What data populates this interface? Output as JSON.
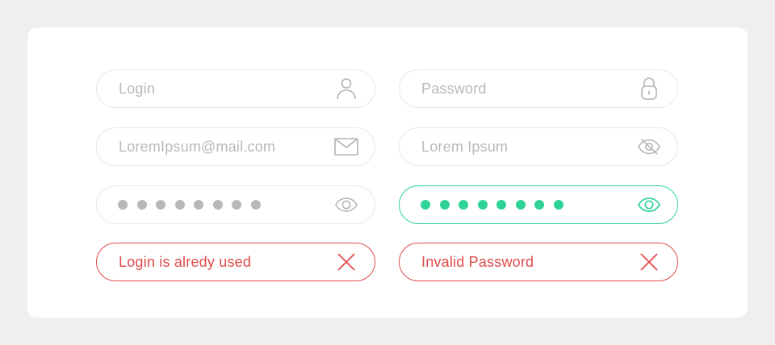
{
  "fields": {
    "login": {
      "placeholder": "Login",
      "icon": "user-icon"
    },
    "password": {
      "placeholder": "Password",
      "icon": "lock-icon"
    },
    "email": {
      "value": "LoremIpsum@mail.com",
      "icon": "mail-icon"
    },
    "name": {
      "value": "Lorem Ipsum",
      "icon": "eye-off-icon"
    },
    "password_hidden": {
      "masked_length": 8,
      "icon": "eye-icon",
      "state": "default"
    },
    "password_visible": {
      "masked_length": 8,
      "icon": "eye-icon",
      "state": "valid"
    },
    "login_error": {
      "message": "Login is alredy used",
      "icon": "close-icon",
      "state": "error"
    },
    "password_error": {
      "message": "Invalid Password",
      "icon": "close-icon",
      "state": "error"
    }
  },
  "colors": {
    "background": "#efefef",
    "card": "#ffffff",
    "border": "#e7e7e7",
    "placeholder": "#b9b9b9",
    "valid": "#2fd396",
    "error": "#e14b4b"
  }
}
